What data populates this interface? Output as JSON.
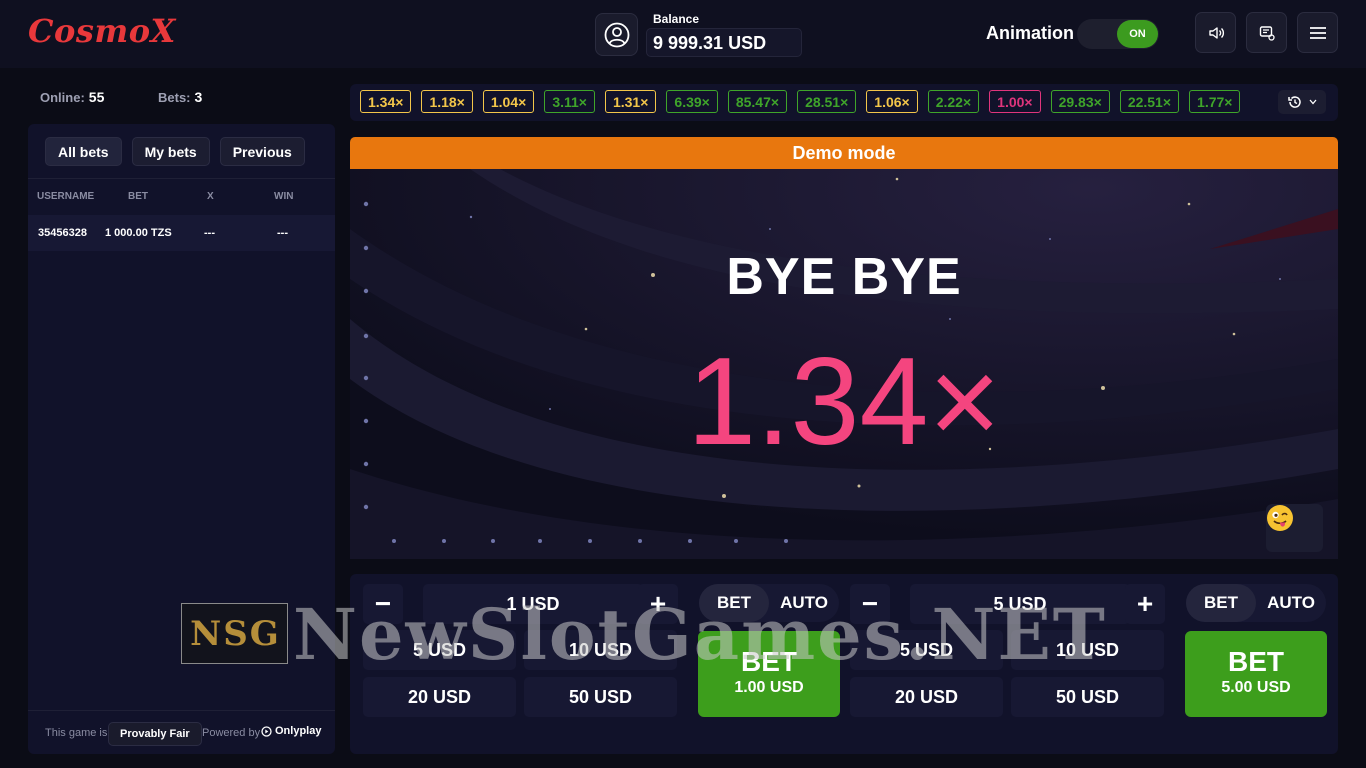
{
  "header": {
    "logo": "CosmoX",
    "balance_label": "Balance",
    "balance_value": "9 999.31 USD",
    "animation_label": "Animation",
    "animation_state": "ON"
  },
  "stats": {
    "online_label": "Online:",
    "online_value": "55",
    "bets_label": "Bets:",
    "bets_value": "3"
  },
  "left_panel": {
    "tabs": [
      "All bets",
      "My bets",
      "Previous"
    ],
    "columns": [
      "USERNAME",
      "BET",
      "X",
      "WIN"
    ],
    "rows": [
      {
        "username": "35456328",
        "bet": "1 000.00 TZS",
        "x": "---",
        "win": "---"
      }
    ],
    "footer": {
      "game_is": "This game is",
      "provably_fair": "Provably Fair",
      "powered_by": "Powered by",
      "provider": "Onlyplay"
    }
  },
  "history": [
    {
      "value": "1.34×",
      "color": "#f3c64a"
    },
    {
      "value": "1.18×",
      "color": "#f3c64a"
    },
    {
      "value": "1.04×",
      "color": "#f3c64a"
    },
    {
      "value": "3.11×",
      "color": "#3fa52a"
    },
    {
      "value": "1.31×",
      "color": "#f3c64a"
    },
    {
      "value": "6.39×",
      "color": "#3fa52a"
    },
    {
      "value": "85.47×",
      "color": "#3fa52a"
    },
    {
      "value": "28.51×",
      "color": "#3fa52a"
    },
    {
      "value": "1.06×",
      "color": "#f3c64a"
    },
    {
      "value": "2.22×",
      "color": "#3fa52a"
    },
    {
      "value": "1.00×",
      "color": "#e0357c"
    },
    {
      "value": "29.83×",
      "color": "#3fa52a"
    },
    {
      "value": "22.51×",
      "color": "#3fa52a"
    },
    {
      "value": "1.77×",
      "color": "#3fa52a"
    }
  ],
  "game": {
    "demo_label": "Demo mode",
    "status": "BYE BYE",
    "multiplier": "1.34×",
    "multiplier_color": "#f4457f"
  },
  "bets": [
    {
      "amount": "1 USD",
      "mode_bet": "BET",
      "mode_auto": "AUTO",
      "quick": [
        "5 USD",
        "10 USD",
        "20 USD",
        "50 USD"
      ],
      "bet_label": "BET",
      "bet_amount": "1.00 USD"
    },
    {
      "amount": "5 USD",
      "mode_bet": "BET",
      "mode_auto": "AUTO",
      "quick": [
        "5 USD",
        "10 USD",
        "20 USD",
        "50 USD"
      ],
      "bet_label": "BET",
      "bet_amount": "5.00 USD"
    }
  ],
  "watermark": {
    "logo": [
      "N",
      "S",
      "G"
    ],
    "text": "NewSlotGames.NET"
  }
}
